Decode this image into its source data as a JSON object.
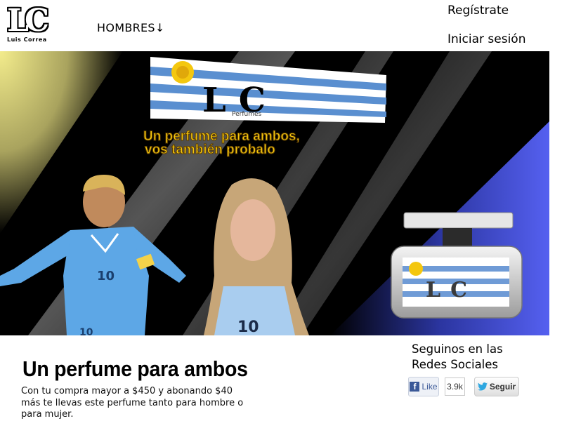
{
  "header": {
    "logo_mark": "LC",
    "logo_name": "Luis Correa",
    "nav_men": "HOMBRES↓",
    "register": "Regístrate",
    "login": "Iniciar sesión"
  },
  "banner": {
    "flag_mark": "LC",
    "flag_sub": "Perfumes",
    "slogan_line1": "Un perfume para ambos,",
    "slogan_line2": "vos también probalo",
    "jersey_number": "10",
    "bottle_mark": "LC",
    "colors": {
      "sky_blue": "#75aadb",
      "blue": "#3f4fd8",
      "yellow": "#f3ec8c",
      "slogan": "#f4c70f"
    }
  },
  "promo": {
    "title": "Un perfume para ambos",
    "text": "Con tu compra mayor a $450 y abonando $40 más te llevas este perfume tanto para hombre o para mujer."
  },
  "social": {
    "heading": "Seguinos en las Redes Sociales",
    "fb_icon": "f",
    "fb_label": "Like",
    "fb_count": "3.9k",
    "tw_label": "Seguir"
  }
}
